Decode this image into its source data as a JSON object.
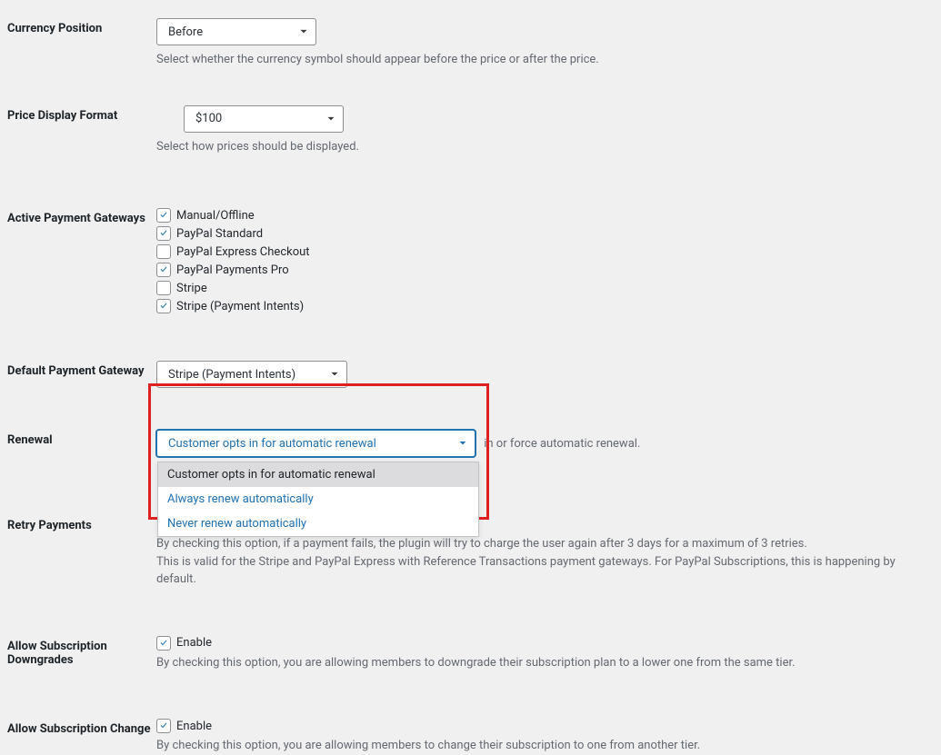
{
  "currency_position": {
    "label": "Currency Position",
    "value": "Before",
    "description": "Select whether the currency symbol should appear before the price or after the price."
  },
  "price_display": {
    "label": "Price Display Format",
    "value": "$100",
    "description": "Select how prices should be displayed."
  },
  "active_gateways": {
    "label": "Active Payment Gateways",
    "items": [
      {
        "label": "Manual/Offline",
        "checked": true
      },
      {
        "label": "PayPal Standard",
        "checked": true
      },
      {
        "label": "PayPal Express Checkout",
        "checked": false
      },
      {
        "label": "PayPal Payments Pro",
        "checked": true
      },
      {
        "label": "Stripe",
        "checked": false
      },
      {
        "label": "Stripe (Payment Intents)",
        "checked": true
      }
    ]
  },
  "default_gateway": {
    "label": "Default Payment Gateway",
    "value": "Stripe (Payment Intents)"
  },
  "renewal": {
    "label": "Renewal",
    "selected": "Customer opts in for automatic renewal",
    "options": [
      "Customer opts in for automatic renewal",
      "Always renew automatically",
      "Never renew automatically"
    ],
    "description_tail": "in or force automatic renewal."
  },
  "retry_payments": {
    "label": "Retry Payments",
    "line1": "By checking this option, if a payment fails, the plugin will try to charge the user again after 3 days for a maximum of 3 retries.",
    "line2": "This is valid for the Stripe and PayPal Express with Reference Transactions payment gateways. For PayPal Subscriptions, this is happening by default."
  },
  "allow_downgrades": {
    "label": "Allow Subscription Downgrades",
    "enable": "Enable",
    "checked": true,
    "description": "By checking this option, you are allowing members to downgrade their subscription plan to a lower one from the same tier."
  },
  "allow_change": {
    "label": "Allow Subscription Change",
    "enable": "Enable",
    "checked": true,
    "description": "By checking this option, you are allowing members to change their subscription to one from another tier."
  }
}
